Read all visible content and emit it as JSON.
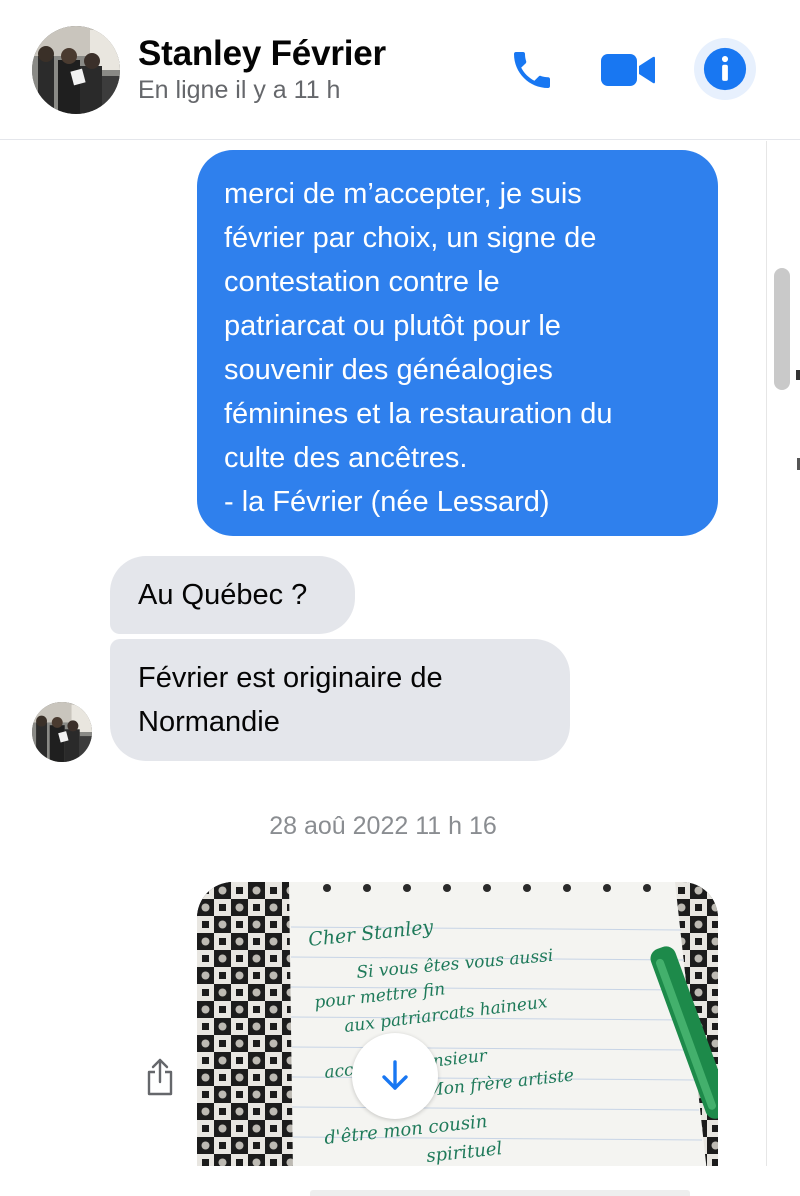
{
  "header": {
    "contact_name": "Stanley Février",
    "status": "En ligne il y a 11 h",
    "call_icon": "phone-icon",
    "video_icon": "video-camera-icon",
    "info_icon": "info-icon",
    "accent_color": "#1877f2"
  },
  "messages": {
    "outgoing_1": "merci de m’accepter, je suis\nfévrier par choix, un signe de\ncontestation contre le\npatriarcat ou plutôt pour le\nsouvenir des généalogies\nféminines et la restauration du\nculte des ancêtres.\n- la Février (née Lessard)",
    "incoming_1": "Au Québec ?",
    "incoming_2": "Février est originaire de\nNormandie",
    "outgoing_bubble_color": "#2f80ed",
    "incoming_bubble_color": "#e4e6eb"
  },
  "timestamp": "28 aoû 2022 11 h 16",
  "photo": {
    "handwritten_text": [
      "Cher Stanley",
      "Si vous êtes vous aussi",
      "pour mettre fin",
      "aux patriarcats haineux",
      "acceptez Monsieur",
      "Mon frère artiste",
      "d'être mon cousin",
      "spirituel"
    ],
    "share_icon": "share-icon",
    "download_icon": "download-arrow-icon"
  }
}
